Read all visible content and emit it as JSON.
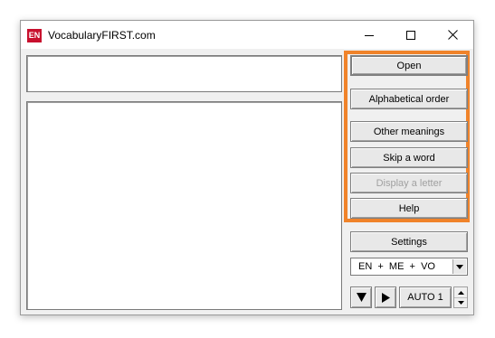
{
  "window": {
    "title": "VocabularyFIRST.com",
    "icon_text": "EN",
    "controls": [
      "minimize-icon",
      "maximize-icon",
      "close-icon"
    ]
  },
  "buttons": {
    "open": "Open",
    "alphabetical_order": "Alphabetical order",
    "other_meanings": "Other meanings",
    "skip_word": "Skip a word",
    "display_letter": "Display a letter",
    "help": "Help",
    "settings": "Settings"
  },
  "language_combo": {
    "value": "EN  +  ME  +  VO"
  },
  "playback": {
    "down_icon": "down-triangle-icon",
    "play_icon": "play-icon",
    "auto_value": "AUTO 1"
  },
  "colors": {
    "highlight": "#f0832a",
    "icon_bg": "#c8102e",
    "disabled_text": "#a0a0a0"
  }
}
